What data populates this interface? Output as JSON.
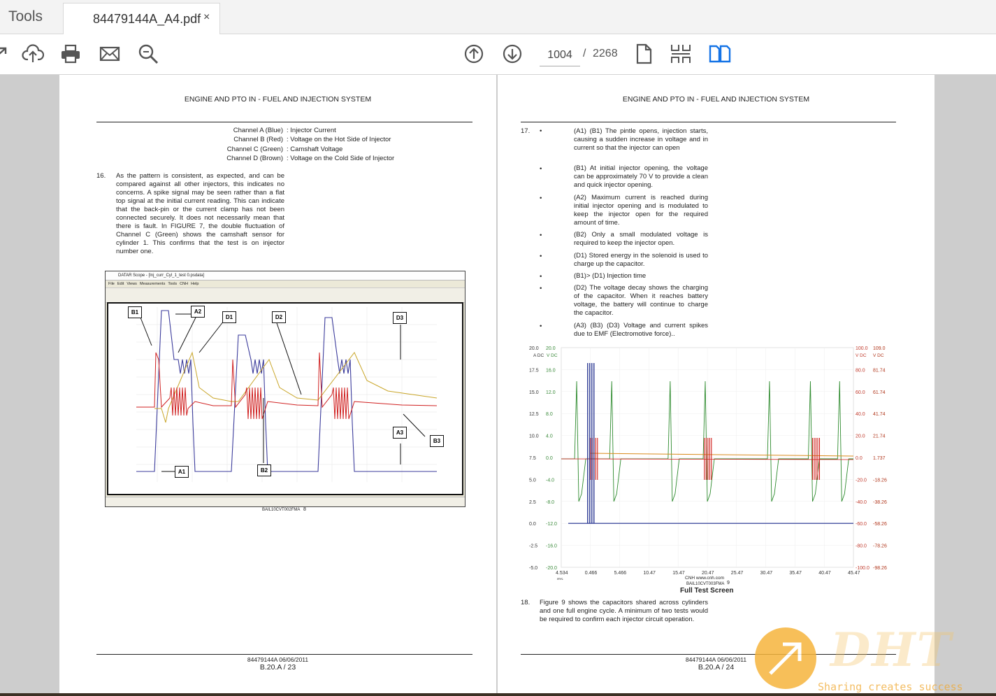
{
  "tabs": {
    "tools": "Tools",
    "document": "84479144A_A4.pdf",
    "close": "×"
  },
  "toolbar": {
    "icons": [
      "share-icon",
      "upload-icon",
      "print-icon",
      "email-icon",
      "zoom-search-icon",
      "page-up-icon",
      "page-down-icon",
      "single-page-icon",
      "scroll-mode-icon",
      "two-page-icon"
    ],
    "current_page": "1004",
    "separator": "/",
    "total_pages": "2268",
    "accent": "#1473e6"
  },
  "left_page": {
    "header": "ENGINE AND PTO IN - FUEL AND INJECTION SYSTEM",
    "channels": [
      {
        "name": "Channel A (Blue)",
        "desc": ": Injector Current"
      },
      {
        "name": "Channel B (Red)",
        "desc": ": Voltage on the Hot Side of Injector"
      },
      {
        "name": "Channel C (Green)",
        "desc": ": Camshaft Voltage"
      },
      {
        "name": "Channel D (Brown)",
        "desc": ": Voltage on the Cold Side of Injector"
      }
    ],
    "step_number": "16.",
    "step_text": "As the pattern is consistent, as expected, and can be compared against all other injectors, this indicates no concerns. A spike signal may be seen rather than a flat top signal at the initial current reading. This can indicate that the back-pin or the current clamp has not been connected securely. It does not necessarily mean that there is fault. In FIGURE 7, the double fluctuation of Channel C (Green) shows the camshaft sensor for cylinder 1. This confirms that the test is on injector number one.",
    "scope_title": "DATAR Scope - [Inj_curr_Cyl_1_test 0.psdata]",
    "scope_menu": [
      "File",
      "Edit",
      "Views",
      "Measurements",
      "Tools",
      "CNH",
      "Help"
    ],
    "callouts": [
      "B1",
      "A2",
      "D1",
      "D2",
      "D3",
      "A3",
      "B3",
      "A1",
      "B2"
    ],
    "figure_caption": "BAIL10CVT002FMA",
    "figure_number": "8",
    "footer_code": "84479144A 06/06/2011",
    "footer_page": "B.20.A / 23"
  },
  "right_page": {
    "header": "ENGINE AND PTO IN - FUEL AND INJECTION SYSTEM",
    "step_number": "17.",
    "bullets": [
      "(A1) (B1) The pintle opens, injection starts, causing a sudden increase in voltage and in current so that the injector can open",
      "(B1) At initial injector opening, the voltage can be approximately 70 V to provide a clean and quick injector opening.",
      "(A2) Maximum current is reached during initial injector opening and is modulated to keep the injector open for the required amount of time.",
      "(B2) Only a small modulated voltage is required to keep the injector open.",
      "(D1) Stored energy in the solenoid is used to charge up the capacitor.",
      "(B1)> (D1) Injection time",
      "(D2) The voltage decay shows the charging of the capacitor. When it reaches battery voltage, the battery will continue to charge the capacitor.",
      "(A3) (B3) (D3) Voltage and current spikes due to EMF (Electromotive force).."
    ],
    "bullet_mark": "•",
    "figure_caption": "BAIL10CVT003FMA",
    "figure_number": "9",
    "figure_title": "Full Test Screen",
    "figure_credit": "CNH    www.cnh.com",
    "step2_number": "18.",
    "step2_text": "Figure 9 shows the capacitors shared across cylinders and one full engine cycle. A minimum of two tests would be required to confirm each injector circuit operation.",
    "footer_code": "84479144A 06/06/2011",
    "footer_page": "B.20.A / 24"
  },
  "chart_data": {
    "type": "line",
    "title": "Full Test Screen",
    "xlabel": "ms",
    "x_ticks": [
      "4.534",
      "0.466",
      "5.466",
      "10.47",
      "15.47",
      "20.47",
      "25.47",
      "30.47",
      "35.47",
      "40.47",
      "45.47"
    ],
    "y_left_outer": {
      "unit": "A DC",
      "ticks": [
        "20.0",
        "17.5",
        "15.0",
        "12.5",
        "10.0",
        "7.5",
        "5.0",
        "2.5",
        "0.0",
        "-2.5",
        "-5.0"
      ]
    },
    "y_left_inner": {
      "unit": "V DC",
      "ticks": [
        "20.0",
        "16.0",
        "12.0",
        "8.0",
        "4.0",
        "0.0",
        "-4.0",
        "-8.0",
        "-12.0",
        "-16.0",
        "-20.0"
      ]
    },
    "y_right_inner": {
      "unit": "V DC",
      "ticks": [
        "100.0",
        "80.0",
        "60.0",
        "40.0",
        "20.0",
        "0.0",
        "-20.0",
        "-40.0",
        "-60.0",
        "-80.0",
        "-100.0"
      ]
    },
    "y_right_outer": {
      "unit": "V DC",
      "ticks": [
        "109.0",
        "81.74",
        "61.74",
        "41.74",
        "21.74",
        "1.737",
        "-18.26",
        "-38.26",
        "-58.26",
        "-78.26",
        "-98.26"
      ]
    },
    "series": [],
    "colors": {
      "blue": "#1c2a8c",
      "green": "#2e8b2e",
      "red": "#d0201c",
      "orange": "#d98a1a"
    }
  },
  "watermark": {
    "brand": "DHT",
    "tagline": "Sharing creates success"
  }
}
